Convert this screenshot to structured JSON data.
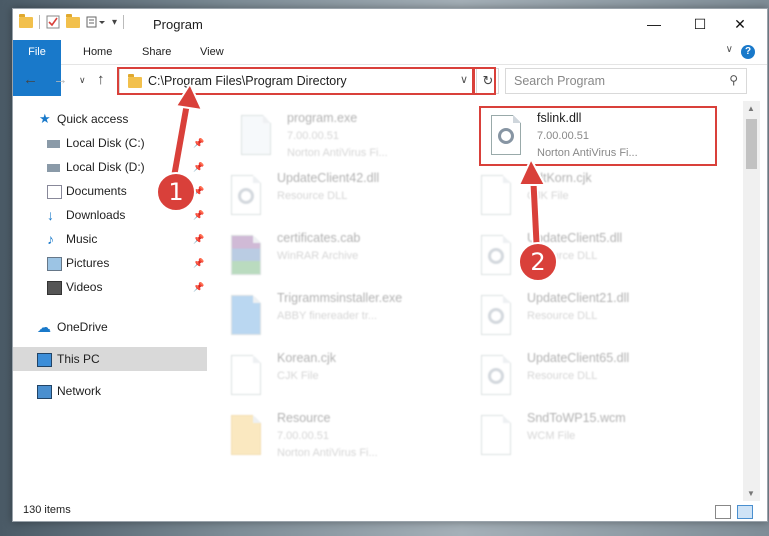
{
  "window": {
    "title": "Program",
    "controls": [
      "minimize-icon",
      "maximize-icon",
      "close-icon"
    ]
  },
  "ribbon": {
    "tabs": [
      "File",
      "Home",
      "Share",
      "View"
    ],
    "help": "?"
  },
  "nav": {
    "address": "C:\\Program Files\\Program Directory",
    "search_placeholder": "Search Program"
  },
  "sidebar": {
    "items": [
      {
        "label": "Quick access",
        "icon": "star-icon",
        "pinned": false
      },
      {
        "label": "Local Disk (C:)",
        "icon": "drive-icon",
        "pinned": true
      },
      {
        "label": "Local Disk (D:)",
        "icon": "drive-icon",
        "pinned": true
      },
      {
        "label": "Documents",
        "icon": "documents-icon",
        "pinned": true
      },
      {
        "label": "Downloads",
        "icon": "downloads-icon",
        "pinned": true
      },
      {
        "label": "Music",
        "icon": "music-icon",
        "pinned": true
      },
      {
        "label": "Pictures",
        "icon": "pictures-icon",
        "pinned": true
      },
      {
        "label": "Videos",
        "icon": "videos-icon",
        "pinned": true
      },
      {
        "label": "OneDrive",
        "icon": "onedrive-icon",
        "pinned": false
      },
      {
        "label": "This PC",
        "icon": "pc-icon",
        "pinned": false,
        "selected": true
      },
      {
        "label": "Network",
        "icon": "network-icon",
        "pinned": false
      }
    ]
  },
  "files": [
    {
      "name": "program.exe",
      "line2": "7.00.00.51",
      "line3": "Norton AntiVirus Fi...",
      "icon": "exe-icon"
    },
    {
      "name": "fslink.dll",
      "line2": "7.00.00.51",
      "line3": "Norton AntiVirus Fi...",
      "icon": "dll-icon",
      "highlighted": true
    },
    {
      "name": "UpdateClient42.dll",
      "line2": "Resource DLL",
      "icon": "dll-icon"
    },
    {
      "name": "DdtKorn.cjk",
      "line2": "CJK File",
      "icon": "file-icon"
    },
    {
      "name": "certificates.cab",
      "line2": "WinRAR Archive",
      "icon": "archive-icon"
    },
    {
      "name": "UpdateClient5.dll",
      "line2": "Resource DLL",
      "icon": "dll-icon"
    },
    {
      "name": "Trigrammsinstaller.exe",
      "line2": "ABBY finereader tr...",
      "icon": "installer-icon"
    },
    {
      "name": "UpdateClient21.dll",
      "line2": "Resource DLL",
      "icon": "dll-icon"
    },
    {
      "name": "Korean.cjk",
      "line2": "CJK File",
      "icon": "file-icon"
    },
    {
      "name": "UpdateClient65.dll",
      "line2": "Resource DLL",
      "icon": "dll-icon"
    },
    {
      "name": "Resource",
      "line2": "7.00.00.51",
      "line3": "Norton AntiVirus Fi...",
      "icon": "folder-icon"
    },
    {
      "name": "SndToWP15.wcm",
      "line2": "WCM File",
      "icon": "file-icon"
    }
  ],
  "status": {
    "count": "130 items"
  },
  "annotations": {
    "step1": "1",
    "step2": "2",
    "color": "#d9403a"
  }
}
